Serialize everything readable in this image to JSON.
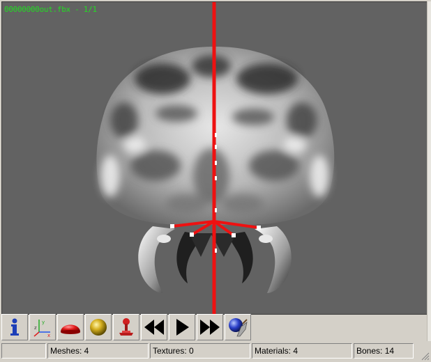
{
  "viewport": {
    "overlay_title": "00000000out.fbx - 1/1",
    "background": "#626262",
    "overlay_color": "#22dd22",
    "bone_color": "#ee1111"
  },
  "toolbar": {
    "buttons": [
      {
        "name": "info-button",
        "icon": "info-icon"
      },
      {
        "name": "axis-button",
        "icon": "xyz-axis-icon"
      },
      {
        "name": "dome-button",
        "icon": "red-hemisphere-icon"
      },
      {
        "name": "sphere-button",
        "icon": "gold-sphere-icon"
      },
      {
        "name": "joystick-button",
        "icon": "joystick-icon"
      },
      {
        "name": "rewind-button",
        "icon": "rewind-icon"
      },
      {
        "name": "play-button",
        "icon": "play-icon"
      },
      {
        "name": "fast-forward-button",
        "icon": "fast-forward-icon"
      },
      {
        "name": "paint-button",
        "icon": "paint-ball-brush-icon"
      }
    ]
  },
  "status": {
    "pane0": "",
    "meshes": "Meshes: 4",
    "textures": "Textures: 0",
    "materials": "Materials: 4",
    "bones": "Bones: 14"
  }
}
